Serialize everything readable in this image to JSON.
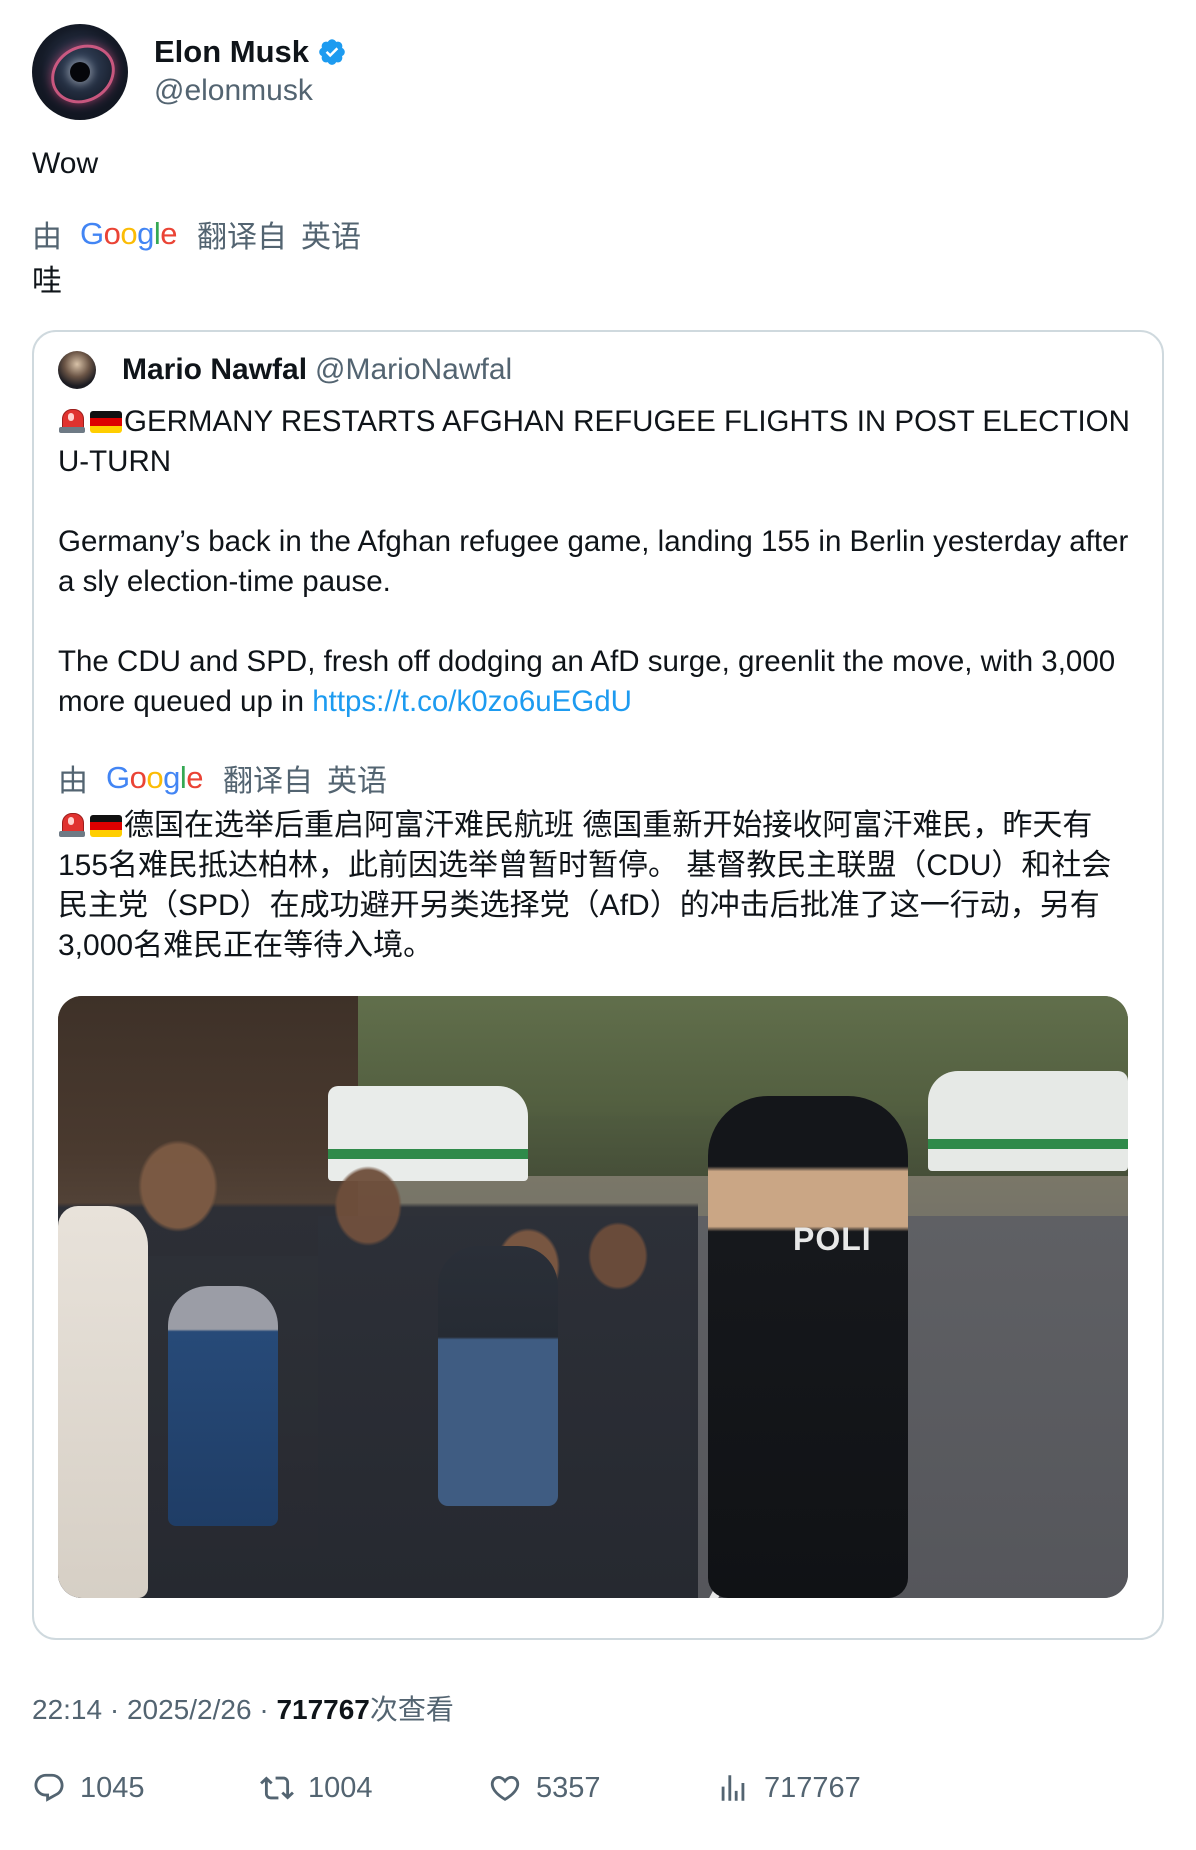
{
  "author": {
    "display_name": "Elon Musk",
    "handle": "@elonmusk",
    "verified": true
  },
  "tweet": {
    "text": "Wow",
    "translate_by": "由",
    "translate_from": "翻译自",
    "translate_lang": "英语",
    "translated_text": "哇"
  },
  "google_logo": {
    "letters": [
      "G",
      "o",
      "o",
      "g",
      "l",
      "e"
    ]
  },
  "quote": {
    "display_name": "Mario Nawfal",
    "handle": "@MarioNawfal",
    "headline_line": "GERMANY RESTARTS AFGHAN REFUGEE FLIGHTS IN POST ELECTION U-TURN",
    "paragraph_1": "Germany’s back in the Afghan refugee game, landing 155 in Berlin yesterday after a sly election-time pause.",
    "paragraph_2": "The CDU and SPD, fresh off dodging an AfD surge, greenlit the move, with 3,000 more queued up in ",
    "link": "https://t.co/k0zo6uEGdU",
    "translate_by": "由",
    "translate_from": "翻译自",
    "translate_lang": "英语",
    "translated_text": "德国在选举后重启阿富汗难民航班 德国重新开始接收阿富汗难民，昨天有155名难民抵达柏林，此前因选举曾暂时暂停。 基督教民主联盟（CDU）和社会民主党（SPD）在成功避开另类选择党（AfD）的冲击后批准了这一行动，另有3,000名难民正在等待入境。",
    "photo_text": "POLI"
  },
  "meta": {
    "time": "22:14",
    "separator": "·",
    "date": "2025/2/26",
    "views_count": "717767",
    "views_label": "次查看"
  },
  "actions": {
    "replies": "1045",
    "retweets": "1004",
    "likes": "5357",
    "views": "717767"
  },
  "colors": {
    "accent": "#1d9bf0",
    "text_primary": "#0f1419",
    "text_secondary": "#536471",
    "border": "#cfd9de"
  },
  "icons": {
    "verified": "verified-badge-icon",
    "reply": "reply-icon",
    "retweet": "retweet-icon",
    "like": "heart-icon",
    "views": "views-chart-icon",
    "siren": "siren-emoji-icon",
    "flag": "germany-flag-emoji-icon"
  }
}
